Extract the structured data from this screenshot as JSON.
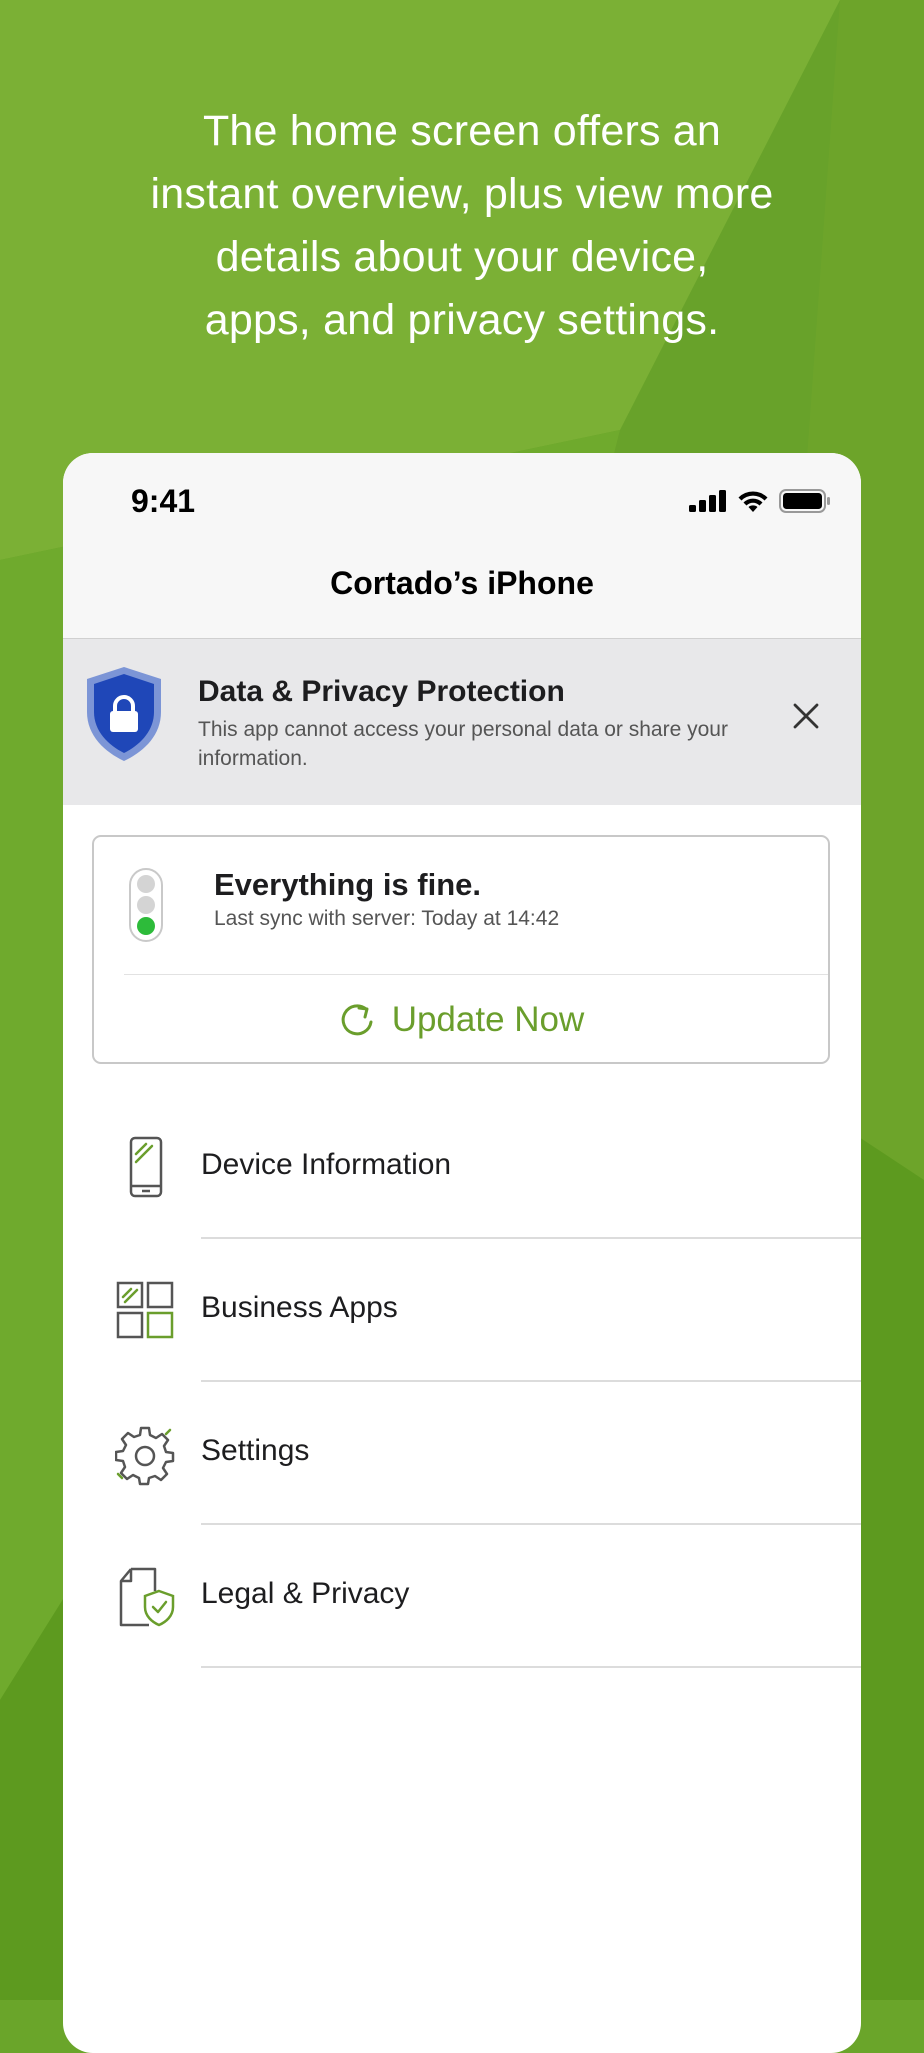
{
  "headline": "The home screen offers an\ninstant overview, plus view more\ndetails about your device,\napps, and privacy settings.",
  "colors": {
    "background": "#6aa52a",
    "accent": "#6a9e2c",
    "shield": "#1f47b8",
    "ok_light": "#2dbb3a"
  },
  "statusbar": {
    "time": "9:41",
    "icons": [
      "cellular-signal-icon",
      "wifi-icon",
      "battery-icon"
    ]
  },
  "navbar": {
    "title": "Cortado’s iPhone"
  },
  "banner": {
    "title": "Data & Privacy Protection",
    "text": "This app cannot access your personal data or share your information.",
    "icon": "shield-lock-icon",
    "close_icon": "close-icon"
  },
  "status_card": {
    "title": "Everything is fine.",
    "subtitle": "Last sync with server: Today at 14:42",
    "update_label": "Update Now",
    "icon": "traffic-light-icon"
  },
  "menu": [
    {
      "label": "Device Information",
      "icon": "smartphone-icon"
    },
    {
      "label": "Business Apps",
      "icon": "app-grid-icon"
    },
    {
      "label": "Settings",
      "icon": "gear-icon"
    },
    {
      "label": "Legal & Privacy",
      "icon": "document-shield-icon"
    }
  ]
}
